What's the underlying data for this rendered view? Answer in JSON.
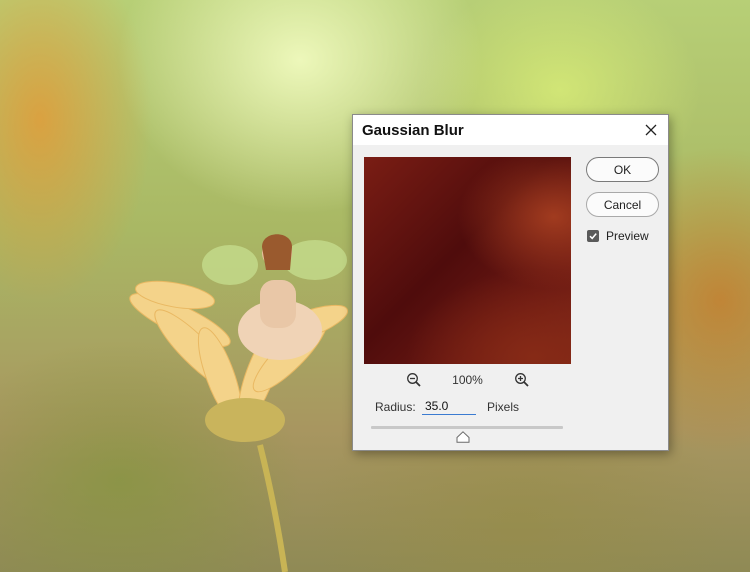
{
  "dialog": {
    "title": "Gaussian Blur",
    "ok_label": "OK",
    "cancel_label": "Cancel",
    "preview_label": "Preview",
    "preview_checked": true,
    "zoom_level": "100%",
    "radius_label": "Radius:",
    "radius_value": "35.0",
    "units_label": "Pixels",
    "slider_value_fraction": 0.48
  },
  "icons": {
    "close": "close-icon",
    "zoom_out": "zoom-out-icon",
    "zoom_in": "zoom-in-icon",
    "slider_thumb": "slider-thumb-icon",
    "checkbox": "checkmark-icon"
  },
  "colors": {
    "dialog_bg": "#f0f0f0",
    "titlebar_bg": "#ffffff",
    "preview_swatch": "#6a1812",
    "input_underline": "#3b7bd1"
  }
}
